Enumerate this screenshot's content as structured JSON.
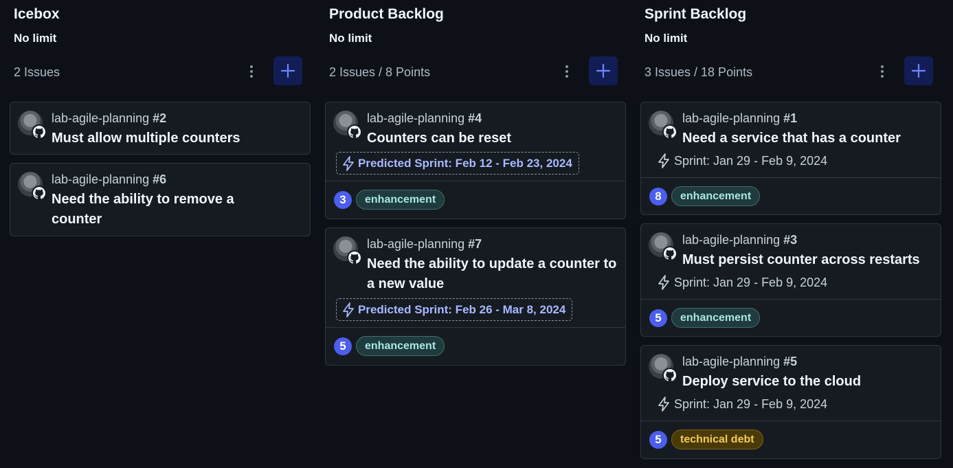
{
  "colors": {
    "background": "#0d1117",
    "card": "#161b22",
    "points_badge": "#4c5eef",
    "label_enhancement": "#1f3b3e",
    "label_technical_debt": "#4a3a08",
    "add_button": "#121d55"
  },
  "icons": {
    "menu": "kebab-vertical-icon",
    "add": "plus-icon",
    "avatar": "avatar-icon",
    "source": "github-icon",
    "sprint": "lightning-icon"
  },
  "columns": [
    {
      "title": "Icebox",
      "limit": "No limit",
      "count": "2 Issues",
      "cards": [
        {
          "repo": "lab-agile-planning",
          "number": "#2",
          "title": "Must allow multiple counters"
        },
        {
          "repo": "lab-agile-planning",
          "number": "#6",
          "title": "Need the ability to remove a counter"
        }
      ]
    },
    {
      "title": "Product Backlog",
      "limit": "No limit",
      "count": "2 Issues / 8 Points",
      "cards": [
        {
          "repo": "lab-agile-planning",
          "number": "#4",
          "title": "Counters can be reset",
          "predicted_sprint": "Predicted Sprint: Feb 12 - Feb 23, 2024",
          "points": "3",
          "label": "enhancement"
        },
        {
          "repo": "lab-agile-planning",
          "number": "#7",
          "title": "Need the ability to update a counter to a new value",
          "predicted_sprint": "Predicted Sprint: Feb 26 - Mar 8, 2024",
          "points": "5",
          "label": "enhancement"
        }
      ]
    },
    {
      "title": "Sprint Backlog",
      "limit": "No limit",
      "count": "3 Issues / 18 Points",
      "cards": [
        {
          "repo": "lab-agile-planning",
          "number": "#1",
          "title": "Need a service that has a counter",
          "sprint": "Sprint: Jan 29 - Feb 9, 2024",
          "points": "8",
          "label": "enhancement"
        },
        {
          "repo": "lab-agile-planning",
          "number": "#3",
          "title": "Must persist counter across restarts",
          "sprint": "Sprint: Jan 29 - Feb 9, 2024",
          "points": "5",
          "label": "enhancement"
        },
        {
          "repo": "lab-agile-planning",
          "number": "#5",
          "title": "Deploy service to the cloud",
          "sprint": "Sprint: Jan 29 - Feb 9, 2024",
          "points": "5",
          "label": "technical debt"
        }
      ]
    }
  ]
}
